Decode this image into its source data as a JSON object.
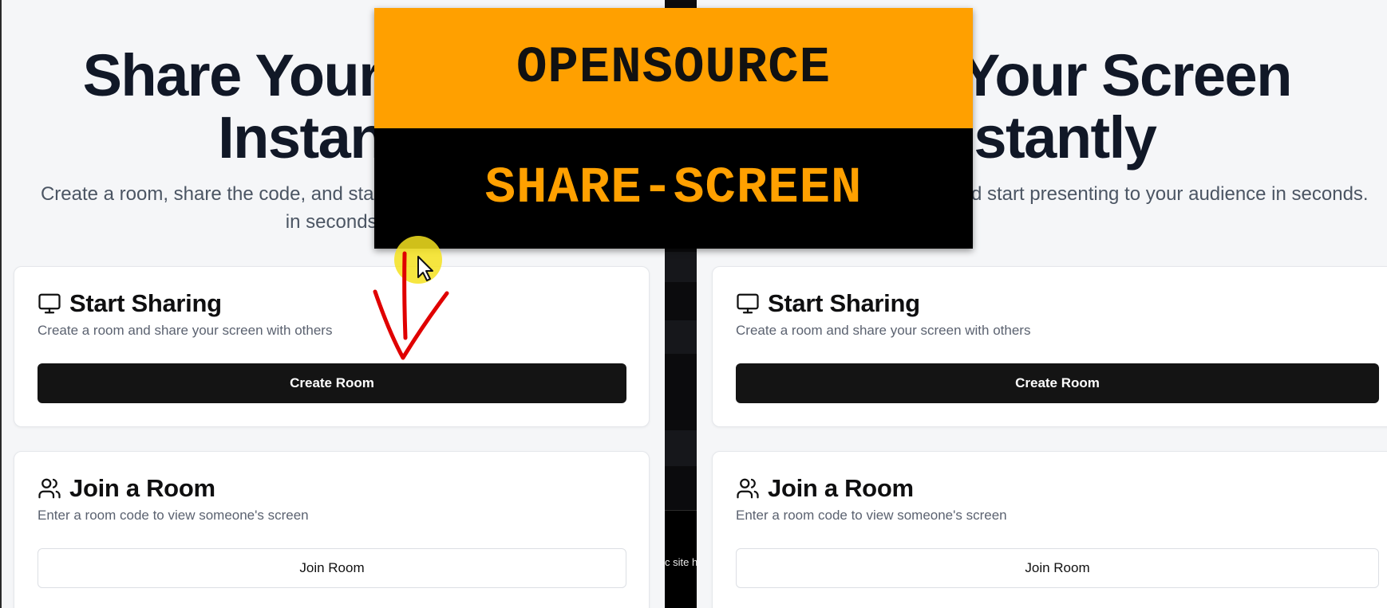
{
  "hero": {
    "title_line1": "Share Your Screen",
    "title_line2": "Instantly",
    "subtitle": "Create a room, share the code, and start presenting to your audience in seconds."
  },
  "start_card": {
    "icon": "monitor-icon",
    "title": "Start Sharing",
    "description": "Create a room and share your screen with others",
    "button_label": "Create Room"
  },
  "join_card": {
    "icon": "users-icon",
    "title": "Join a Room",
    "description": "Enter a room code to view someone's screen",
    "button_label": "Join Room"
  },
  "divider_footer_text": "c site h",
  "banner": {
    "line1": "OPENSOURCE",
    "line2": "SHARE-SCREEN",
    "colors": {
      "accent": "#ffa000",
      "dark": "#000000"
    }
  },
  "annotation": {
    "arrow_color": "#e00000",
    "cursor_highlight": "#f5e21f"
  }
}
